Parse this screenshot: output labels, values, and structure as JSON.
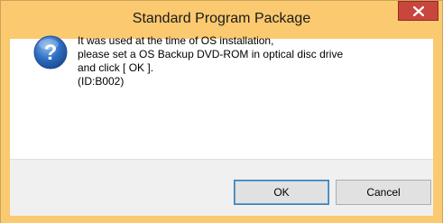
{
  "window": {
    "title": "Standard Program Package",
    "close_icon": "close-icon"
  },
  "message": {
    "icon": "question-icon",
    "lines": [
      "It was used at the time of OS installation,",
      "please set a OS Backup DVD-ROM in optical disc drive",
      "and click [ OK ].",
      "(ID:B002)"
    ]
  },
  "buttons": {
    "ok_label": "OK",
    "cancel_label": "Cancel"
  },
  "colors": {
    "titlebar": "#fbc96f",
    "close_button": "#c7463d",
    "icon_blue": "#2f6fc3"
  }
}
